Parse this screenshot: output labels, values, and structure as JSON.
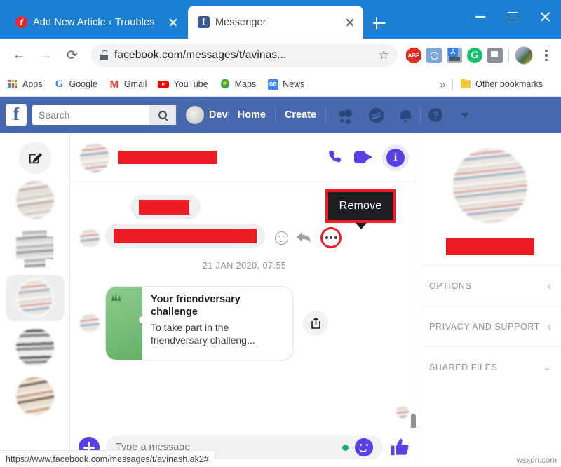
{
  "browser": {
    "tabs": [
      {
        "title": "Add New Article ‹ Troubles",
        "favicon": "red-circle-icon",
        "active": false
      },
      {
        "title": "Messenger",
        "favicon": "facebook-icon",
        "active": true
      }
    ],
    "window_controls": {
      "minimize": "minimize-icon",
      "maximize": "maximize-icon",
      "close": "close-icon"
    },
    "new_tab_label": "+",
    "nav": {
      "back": "back-arrow-icon",
      "forward": "forward-arrow-icon",
      "reload": "reload-icon"
    },
    "omnibox": {
      "url": "facebook.com/messages/t/avinas...",
      "lock": "lock-icon",
      "star": "☆"
    },
    "extensions": [
      {
        "name": "adblock-plus-icon",
        "label": "ABP"
      },
      {
        "name": "camera-icon",
        "label": ""
      },
      {
        "name": "translate-icon",
        "label": ""
      },
      {
        "name": "grammarly-icon",
        "label": "G"
      },
      {
        "name": "screenshot-icon",
        "label": ""
      }
    ],
    "profile_avatar": "user-avatar",
    "menu": "kebab-menu-icon",
    "bookmarks": [
      {
        "label": "Apps",
        "icon": "apps-grid-icon"
      },
      {
        "label": "Google",
        "icon": "google-icon"
      },
      {
        "label": "Gmail",
        "icon": "gmail-icon"
      },
      {
        "label": "YouTube",
        "icon": "youtube-icon"
      },
      {
        "label": "Maps",
        "icon": "maps-pin-icon"
      },
      {
        "label": "News",
        "icon": "news-icon"
      }
    ],
    "bookmarks_overflow": "»",
    "other_bookmarks": "Other bookmarks",
    "statusbar_url": "https://www.facebook.com/messages/t/avinash.ak2#"
  },
  "facebook_bar": {
    "logo": "f",
    "search_placeholder": "Search",
    "search_value": "",
    "search_button": "search-icon",
    "user_name": "Dev",
    "links": [
      "Home",
      "Create"
    ],
    "icons": [
      "friend-requests-icon",
      "messenger-icon",
      "notifications-icon",
      "help-icon",
      "account-dropdown-icon"
    ]
  },
  "messenger": {
    "rail": {
      "compose": "compose-icon",
      "conversations": [
        {
          "id": 1,
          "selected": false
        },
        {
          "id": 2,
          "selected": false
        },
        {
          "id": 3,
          "selected": true
        },
        {
          "id": 4,
          "selected": false
        },
        {
          "id": 5,
          "selected": false
        }
      ]
    },
    "header": {
      "name_redacted": true,
      "actions": [
        "audio-call-icon",
        "video-call-icon",
        "conversation-info-icon"
      ]
    },
    "thread": {
      "messages": [
        {
          "type": "redacted-bubble",
          "size": "short"
        },
        {
          "type": "redacted-bubble",
          "size": "long"
        }
      ],
      "hover_actions": [
        "react-emoji-icon",
        "reply-icon",
        "more-actions-icon"
      ],
      "tooltip": "Remove",
      "timestamp": "21 JAN 2020, 07:55",
      "card": {
        "title": "Your friendversary challenge",
        "subtitle": "To take part in the friendversary challeng...",
        "share_icon": "share-icon",
        "thumb_color": "#7cc07c"
      }
    },
    "composer": {
      "add_icon": "plus-circle-icon",
      "placeholder": "Type a message",
      "value": "",
      "status_dot": "online-dot",
      "emoji_icon": "emoji-icon",
      "like_icon": "thumbs-up-icon"
    },
    "right_panel": {
      "sections": [
        {
          "label": "OPTIONS",
          "chevron": "chevron-left-icon"
        },
        {
          "label": "PRIVACY AND SUPPORT",
          "chevron": "chevron-left-icon"
        },
        {
          "label": "SHARED FILES",
          "chevron": "chevron-down-icon"
        }
      ]
    }
  },
  "watermark": "wsxdn.com",
  "colors": {
    "chrome_blue": "#1b7fd4",
    "facebook_blue": "#4868ad",
    "messenger_purple": "#5b3ee8",
    "redaction_red": "#ec1c24",
    "highlight_red": "#ee1c25"
  }
}
